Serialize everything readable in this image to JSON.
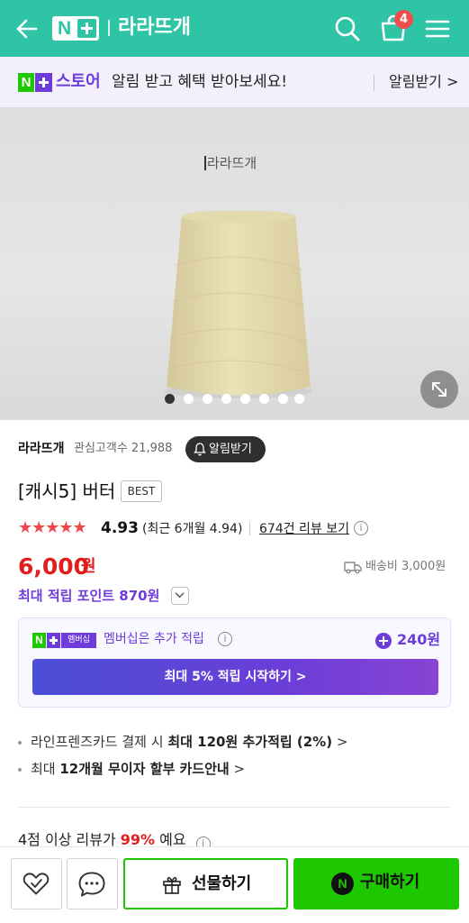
{
  "header": {
    "logo_letter": "N",
    "store_name": "라라뜨개",
    "cart_count": "4"
  },
  "notify_banner": {
    "brand_letter": "N",
    "brand_store": "스토어",
    "message": "알림 받고 혜택 받아보세요!",
    "action": "알림받기 >"
  },
  "hero": {
    "image_brand_text": "라라뜨개",
    "slide_count": 8,
    "active_slide": 1
  },
  "store": {
    "name": "라라뜨개",
    "fans": "관심고객수 21,988",
    "follow_label": "알림받기"
  },
  "product": {
    "title": "[캐시5] 버터",
    "badge": "BEST",
    "stars": "★★★★★",
    "rating": "4.93",
    "recent_rating": "(최근 6개월 4.94)",
    "reviews_link": "674건 리뷰 보기",
    "price": "6,000",
    "price_unit": "원",
    "shipping": "배송비 3,000원",
    "max_points": "최대 적립 포인트 870원"
  },
  "membership": {
    "logo_letter": "N",
    "logo_text": "멤버십",
    "text": "멤버십은 추가 적립",
    "points": "240원",
    "button": "최대 5% 적립 시작하기 >"
  },
  "benefits": [
    {
      "prefix": "라인프렌즈카드 결제 시 ",
      "strong": "최대 120원 추가적립 (2%)",
      "suffix": " >"
    },
    {
      "prefix": "최대 ",
      "strong": "12개월 무이자 할부 카드안내",
      "suffix": " >"
    }
  ],
  "review_summary": {
    "prefix": "4점 이상 리뷰가 ",
    "highlight": "99%",
    "suffix": " 예요"
  },
  "bottom_bar": {
    "gift_label": "선물하기",
    "buy_letter": "N",
    "buy_label": "구매하기"
  },
  "colors": {
    "header_bg": "#2ec4a5",
    "price": "#e01e1e",
    "naver_green": "#1ec800",
    "membership_purple": "#6e3cdb"
  },
  "icons": [
    "back-arrow-icon",
    "search-icon",
    "cart-icon",
    "menu-icon",
    "expand-icon",
    "bell-icon",
    "info-icon",
    "truck-icon",
    "chevron-down-icon",
    "heart-check-icon",
    "chat-icon",
    "gift-icon"
  ]
}
